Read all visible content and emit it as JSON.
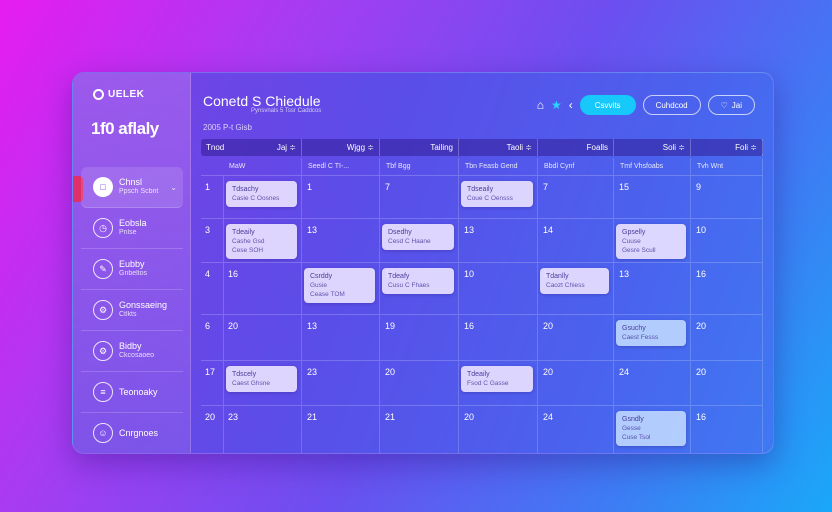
{
  "app": {
    "logo_text": "UELEK",
    "brand": "1f0 aflaly"
  },
  "sidebar": {
    "items": [
      {
        "icon": "calendar-icon",
        "glyph": "□",
        "label": "Chnsl",
        "sub": "Ppsch Scbnt",
        "active": true
      },
      {
        "icon": "clock-icon",
        "glyph": "◷",
        "label": "Eobsla",
        "sub": "Pnlse",
        "active": false
      },
      {
        "icon": "edit-icon",
        "glyph": "✎",
        "label": "Eubby",
        "sub": "Gnbeltos",
        "active": false
      },
      {
        "icon": "gear-icon",
        "glyph": "⚙",
        "label": "Gonssaeing",
        "sub": "Ctlkts",
        "active": false
      },
      {
        "icon": "settings-icon",
        "glyph": "⚙",
        "label": "Bidby",
        "sub": "Ckcosaoeo",
        "active": false
      },
      {
        "icon": "chart-icon",
        "glyph": "≡",
        "label": "Teonoaky",
        "sub": "",
        "active": false
      },
      {
        "icon": "user-icon",
        "glyph": "☺",
        "label": "Cnrgnoes",
        "sub": "",
        "active": false
      }
    ]
  },
  "header": {
    "title": "Conetd S Chiedule",
    "subtitle": "Pynsvnals 5 Tssr Caddcos",
    "range": "2005 P-t Gisb",
    "toolbar": {
      "primary": "Csvvits",
      "secondary": "Cuhdcod",
      "icon_btn": "Jai"
    }
  },
  "calendar": {
    "head": [
      {
        "label": "Tnod",
        "right": "Jaj ≑"
      },
      {
        "label": "",
        "right": "Wjgg ≑"
      },
      {
        "label": "",
        "right": "Tailing"
      },
      {
        "label": "",
        "right": "Taoli ≑"
      },
      {
        "label": "",
        "right": "Foalls"
      },
      {
        "label": "",
        "right": "Soli ≑"
      },
      {
        "label": "",
        "right": "Foli ≑"
      }
    ],
    "subhead": [
      "MaW",
      "Seedl C TI-...",
      "Tbf Bgg",
      "Tbn Feasb Gend",
      "Bbdl Cynf",
      "Tmf Vhsfoabs",
      "Tvh Wnt"
    ],
    "weeks": [
      {
        "label": "1",
        "days": [
          "",
          "1",
          "7",
          "",
          "7",
          "15",
          "9"
        ]
      },
      {
        "label": "3",
        "days": [
          "",
          "13",
          "",
          "13",
          "14",
          "",
          "10"
        ]
      },
      {
        "label": "4",
        "days": [
          "16",
          "",
          "10",
          "10",
          "19",
          "13",
          "16"
        ]
      },
      {
        "label": "6",
        "days": [
          "20",
          "13",
          "19",
          "16",
          "20",
          "",
          "20"
        ]
      },
      {
        "label": "17",
        "days": [
          "",
          "23",
          "20",
          "",
          "20",
          "24",
          "20"
        ]
      },
      {
        "label": "20",
        "days": [
          "23",
          "21",
          "21",
          "20",
          "24",
          "",
          "16"
        ]
      }
    ],
    "events": [
      {
        "week": 0,
        "day": 0,
        "t1": "Tdsachy",
        "t2": "Casie C Oosnes",
        "style": "light"
      },
      {
        "week": 0,
        "day": 3,
        "t1": "Tdseaily",
        "t2": "Coue C Oensss",
        "style": "light"
      },
      {
        "week": 1,
        "day": 0,
        "t1": "Tdeaily",
        "t2": "Cashe Gsd",
        "t3": "Cese SOH",
        "style": "light"
      },
      {
        "week": 1,
        "day": 2,
        "t1": "Dsedhy",
        "t2": "Cesd C Haane",
        "style": "light"
      },
      {
        "week": 1,
        "day": 5,
        "t1": "Gpselly",
        "t2": "Cuuse",
        "t3": "Gesre Scull",
        "style": "light"
      },
      {
        "week": 2,
        "day": 1,
        "t1": "Csrddy",
        "t2": "Gusie",
        "t3": "Cease TOM",
        "style": "light"
      },
      {
        "week": 2,
        "day": 2,
        "t1": "Tdeafy",
        "t2": "Cusu C Fhaes",
        "style": "light"
      },
      {
        "week": 2,
        "day": 4,
        "t1": "Tdanlly",
        "t2": "Caozt Chiess",
        "style": "light"
      },
      {
        "week": 3,
        "day": 5,
        "t1": "Gsuchy",
        "t2": "Caest Fesss",
        "style": "blue"
      },
      {
        "week": 4,
        "day": 0,
        "t1": "Tdscely",
        "t2": "Caest Ghsne",
        "style": "light"
      },
      {
        "week": 4,
        "day": 3,
        "t1": "Tdeaily",
        "t2": "Fsod C Gasse",
        "style": "light"
      },
      {
        "week": 5,
        "day": 5,
        "t1": "Gsndly",
        "t2": "Gesse",
        "t3": "Cuse Tsol",
        "style": "blue"
      }
    ]
  }
}
